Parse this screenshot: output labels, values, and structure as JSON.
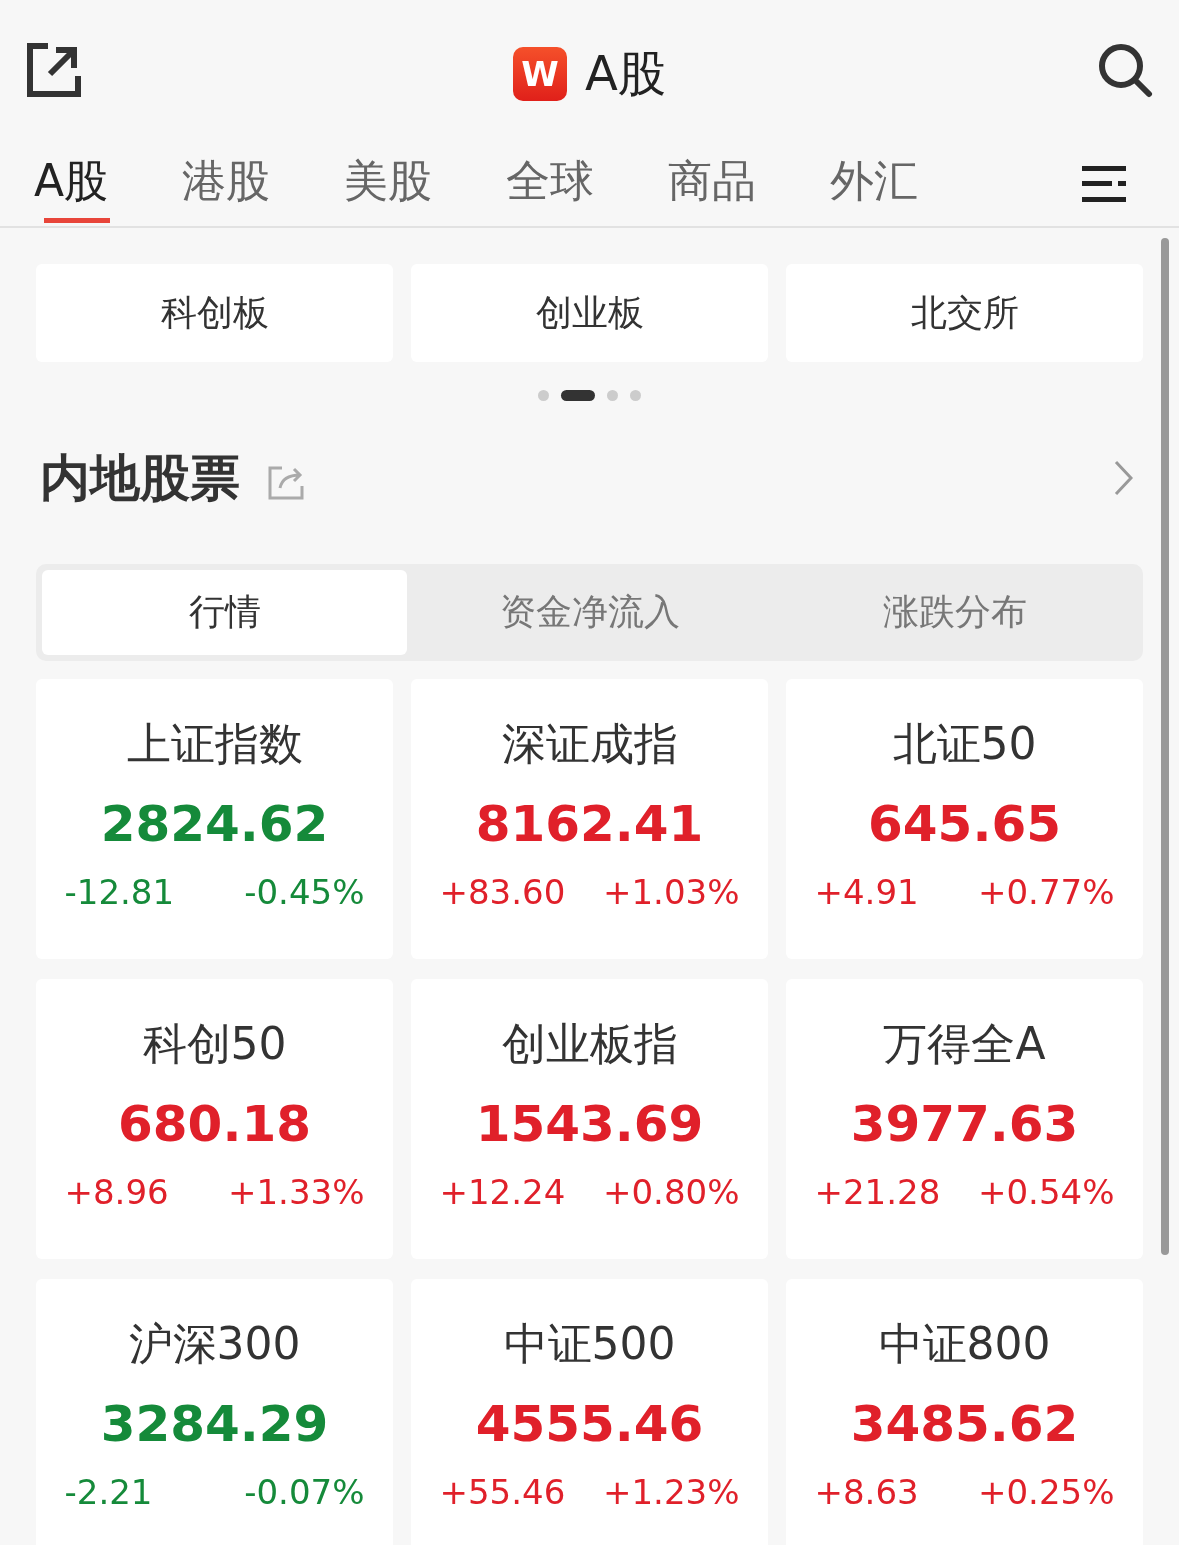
{
  "header": {
    "logo": "W",
    "title": "A股"
  },
  "tabs": [
    {
      "label": "A股",
      "selected": true
    },
    {
      "label": "港股",
      "selected": false
    },
    {
      "label": "美股",
      "selected": false
    },
    {
      "label": "全球",
      "selected": false
    },
    {
      "label": "商品",
      "selected": false
    },
    {
      "label": "外汇",
      "selected": false
    }
  ],
  "shortcuts": [
    "科创板",
    "创业板",
    "北交所"
  ],
  "pager": [
    {
      "selected": false
    },
    {
      "selected": true
    },
    {
      "selected": false
    },
    {
      "selected": false
    }
  ],
  "section": {
    "title": "内地股票"
  },
  "segments": [
    {
      "label": "行情",
      "selected": true
    },
    {
      "label": "资金净流入",
      "selected": false
    },
    {
      "label": "涨跌分布",
      "selected": false
    }
  ],
  "indices": [
    {
      "name": "上证指数",
      "value": "2824.62",
      "change": "-12.81",
      "percent": "-0.45%",
      "kind": "down"
    },
    {
      "name": "深证成指",
      "value": "8162.41",
      "change": "+83.60",
      "percent": "+1.03%",
      "kind": "up"
    },
    {
      "name": "北证50",
      "value": "645.65",
      "change": "+4.91",
      "percent": "+0.77%",
      "kind": "up"
    },
    {
      "name": "科创50",
      "value": "680.18",
      "change": "+8.96",
      "percent": "+1.33%",
      "kind": "up"
    },
    {
      "name": "创业板指",
      "value": "1543.69",
      "change": "+12.24",
      "percent": "+0.80%",
      "kind": "up"
    },
    {
      "name": "万得全A",
      "value": "3977.63",
      "change": "+21.28",
      "percent": "+0.54%",
      "kind": "up"
    },
    {
      "name": "沪深300",
      "value": "3284.29",
      "change": "-2.21",
      "percent": "-0.07%",
      "kind": "down"
    },
    {
      "name": "中证500",
      "value": "4555.46",
      "change": "+55.46",
      "percent": "+1.23%",
      "kind": "up"
    },
    {
      "name": "中证800",
      "value": "3485.62",
      "change": "+8.63",
      "percent": "+0.25%",
      "kind": "up"
    }
  ]
}
